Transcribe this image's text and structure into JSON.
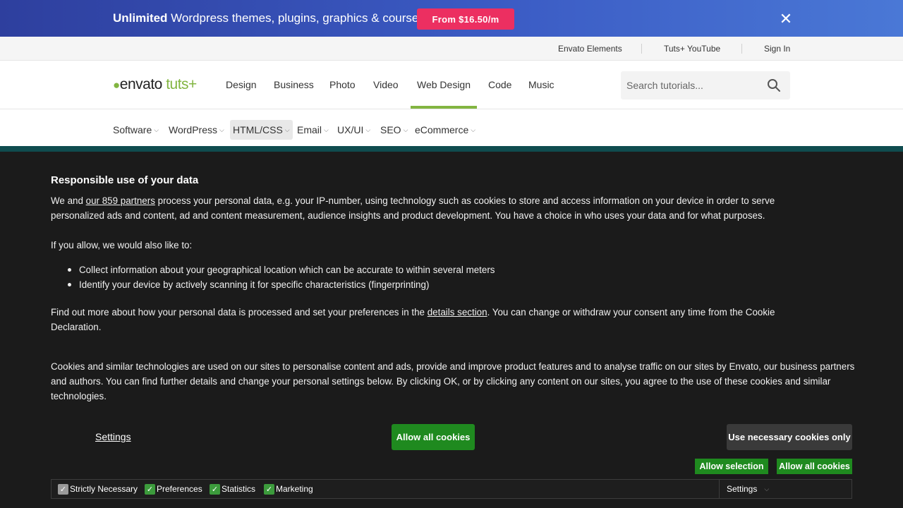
{
  "promo": {
    "bold_text": "Unlimited",
    "text": " Wordpress themes, plugins, graphics & courses!",
    "button_label": "From $16.50/m",
    "close_glyph": "✕"
  },
  "utility": {
    "links": [
      "Envato Elements",
      "Tuts+ YouTube",
      "Sign In"
    ]
  },
  "header": {
    "logo": {
      "leaf": "●",
      "envato": "envato",
      "tuts": "tuts+"
    },
    "nav": [
      "Design",
      "Business",
      "Photo",
      "Video",
      "Web Design",
      "Code",
      "Music"
    ],
    "active_nav": "Web Design",
    "search_placeholder": "Search tutorials...",
    "accent_color": "#82b541"
  },
  "subnav": {
    "items": [
      "Software",
      "WordPress",
      "HTML/CSS",
      "Email",
      "UX/UI",
      "SEO",
      "eCommerce"
    ],
    "active": "HTML/CSS"
  },
  "cookie": {
    "title": "Responsible use of your data",
    "p1_before": "We and ",
    "p1_link": "our 859 partners",
    "p1_after": " process your personal data, e.g. your IP-number, using technology such as cookies to store and access information on your device in order to serve personalized ads and content, ad and content measurement, audience insights and product development. You have a choice in who uses your data and for what purposes.",
    "p2": "If you allow, we would also like to:",
    "bullets": [
      "Collect information about your geographical location which can be accurate to within several meters",
      "Identify your device by actively scanning it for specific characteristics (fingerprinting)"
    ],
    "p3_before": "Find out more about how your personal data is processed and set your preferences in the ",
    "p3_link": "details section",
    "p3_after": ". You can change or withdraw your consent any time from the Cookie Declaration.",
    "p4": "Cookies and similar technologies are used on our sites to personalise content and ads, provide and improve product features and to analyse traffic on our sites by Envato, our business partners and authors. You can find further details and change your personal settings below. By clicking OK, or by clicking any content on our sites, you agree to the use of these cookies and similar technologies.",
    "settings_label": "Settings",
    "allow_all_label": "Allow all cookies",
    "necessary_label": "Use necessary cookies only",
    "allow_selection_label": "Allow selection",
    "allow_all_small_label": "Allow all cookies",
    "checkboxes": [
      {
        "label": "Strictly Necessary",
        "checked": true,
        "disabled": true
      },
      {
        "label": "Preferences",
        "checked": true,
        "disabled": false
      },
      {
        "label": "Statistics",
        "checked": true,
        "disabled": false
      },
      {
        "label": "Marketing",
        "checked": true,
        "disabled": false
      }
    ],
    "bar_settings_label": "Settings",
    "button_color": "#1f8a1f"
  }
}
